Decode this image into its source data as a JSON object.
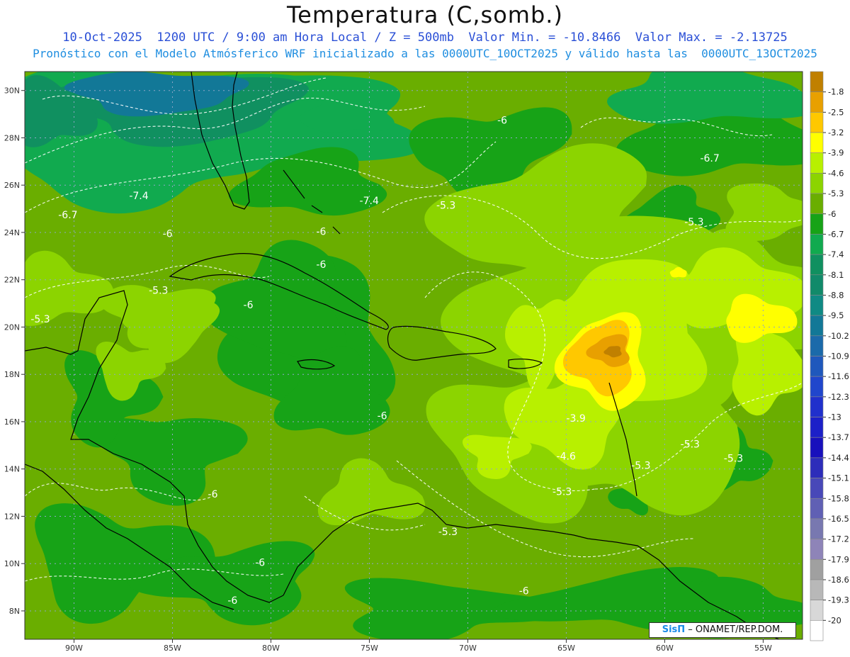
{
  "header": {
    "title": "Temperatura (C,somb.)",
    "line1": "10-Oct-2025  1200 UTC / 9:00 am Hora Local / Z = 500mb  Valor Min. = -10.8466  Valor Max. = -2.13725",
    "line2": "Pronóstico con el Modelo Atmósferico WRF inicializado a las 0000UTC_10OCT2025 y válido hasta las  0000UTC_13OCT2025"
  },
  "map": {
    "lon_range": [
      -92.5,
      -53
    ],
    "lat_range": [
      6.8,
      30.8
    ],
    "lon_ticks": [
      "90W",
      "85W",
      "80W",
      "75W",
      "70W",
      "65W",
      "60W",
      "55W"
    ],
    "lon_values": [
      -90,
      -85,
      -80,
      -75,
      -70,
      -65,
      -60,
      -55
    ],
    "lat_ticks": [
      "30N",
      "28N",
      "26N",
      "24N",
      "22N",
      "20N",
      "18N",
      "16N",
      "14N",
      "12N",
      "10N",
      "8N"
    ],
    "lat_values": [
      30,
      28,
      26,
      24,
      22,
      20,
      18,
      16,
      14,
      12,
      10,
      8
    ],
    "grid": true,
    "contour_labels": [
      {
        "text": "-6",
        "lon": -68.5,
        "lat": 28.6
      },
      {
        "text": "-6.7",
        "lon": -58.2,
        "lat": 27.0
      },
      {
        "text": "-7.4",
        "lon": -87.2,
        "lat": 25.4
      },
      {
        "text": "-7.4",
        "lon": -75.5,
        "lat": 25.2
      },
      {
        "text": "-6.7",
        "lon": -90.8,
        "lat": 24.6
      },
      {
        "text": "-5.3",
        "lon": -71.6,
        "lat": 25.0
      },
      {
        "text": "-5.3",
        "lon": -59.0,
        "lat": 24.3
      },
      {
        "text": "-6",
        "lon": -85.5,
        "lat": 23.8
      },
      {
        "text": "-6",
        "lon": -77.7,
        "lat": 23.9
      },
      {
        "text": "-6",
        "lon": -77.7,
        "lat": 22.5
      },
      {
        "text": "-5.3",
        "lon": -86.2,
        "lat": 21.4
      },
      {
        "text": "-6",
        "lon": -81.4,
        "lat": 20.8
      },
      {
        "text": "-5.3",
        "lon": -92.2,
        "lat": 20.2
      },
      {
        "text": "-6",
        "lon": -74.6,
        "lat": 16.1
      },
      {
        "text": "-3.9",
        "lon": -65.0,
        "lat": 16.0
      },
      {
        "text": "-5.3",
        "lon": -59.2,
        "lat": 14.9
      },
      {
        "text": "-4.6",
        "lon": -65.5,
        "lat": 14.4
      },
      {
        "text": "-5.3",
        "lon": -61.7,
        "lat": 14.0
      },
      {
        "text": "-5.3",
        "lon": -57.0,
        "lat": 14.3
      },
      {
        "text": "-6",
        "lon": -83.2,
        "lat": 12.8
      },
      {
        "text": "-5.3",
        "lon": -65.7,
        "lat": 12.9
      },
      {
        "text": "-5.3",
        "lon": -71.5,
        "lat": 11.2
      },
      {
        "text": "-6",
        "lon": -80.8,
        "lat": 9.9
      },
      {
        "text": "-6",
        "lon": -82.2,
        "lat": 8.3
      },
      {
        "text": "-6",
        "lon": -67.4,
        "lat": 8.7
      }
    ]
  },
  "colorbar": {
    "labels": [
      "-1.8",
      "-2.5",
      "-3.2",
      "-3.9",
      "-4.6",
      "-5.3",
      "-6",
      "-6.7",
      "-7.4",
      "-8.1",
      "-8.8",
      "-9.5",
      "-10.2",
      "-10.9",
      "-11.6",
      "-12.3",
      "-13",
      "-13.7",
      "-14.4",
      "-15.1",
      "-15.8",
      "-16.5",
      "-17.2",
      "-17.9",
      "-18.6",
      "-19.3",
      "-20"
    ],
    "colors": [
      "#c08000",
      "#e8a000",
      "#ffc800",
      "#ffff00",
      "#b8f000",
      "#8cd400",
      "#6aae00",
      "#17a317",
      "#11aa4f",
      "#109060",
      "#118a6a",
      "#0f8a84",
      "#127897",
      "#1b6aaa",
      "#1f58bc",
      "#2046cc",
      "#2030cc",
      "#1c20c8",
      "#1810bc",
      "#2d2dba",
      "#4848b8",
      "#6060b4",
      "#7878b0",
      "#8e84b8",
      "#a0a0a0",
      "#b8b8b8",
      "#d8d8d8",
      "#ffffff"
    ]
  },
  "credit": {
    "brand": "SisΠ",
    "text": " – ONAMET/REP.DOM."
  }
}
